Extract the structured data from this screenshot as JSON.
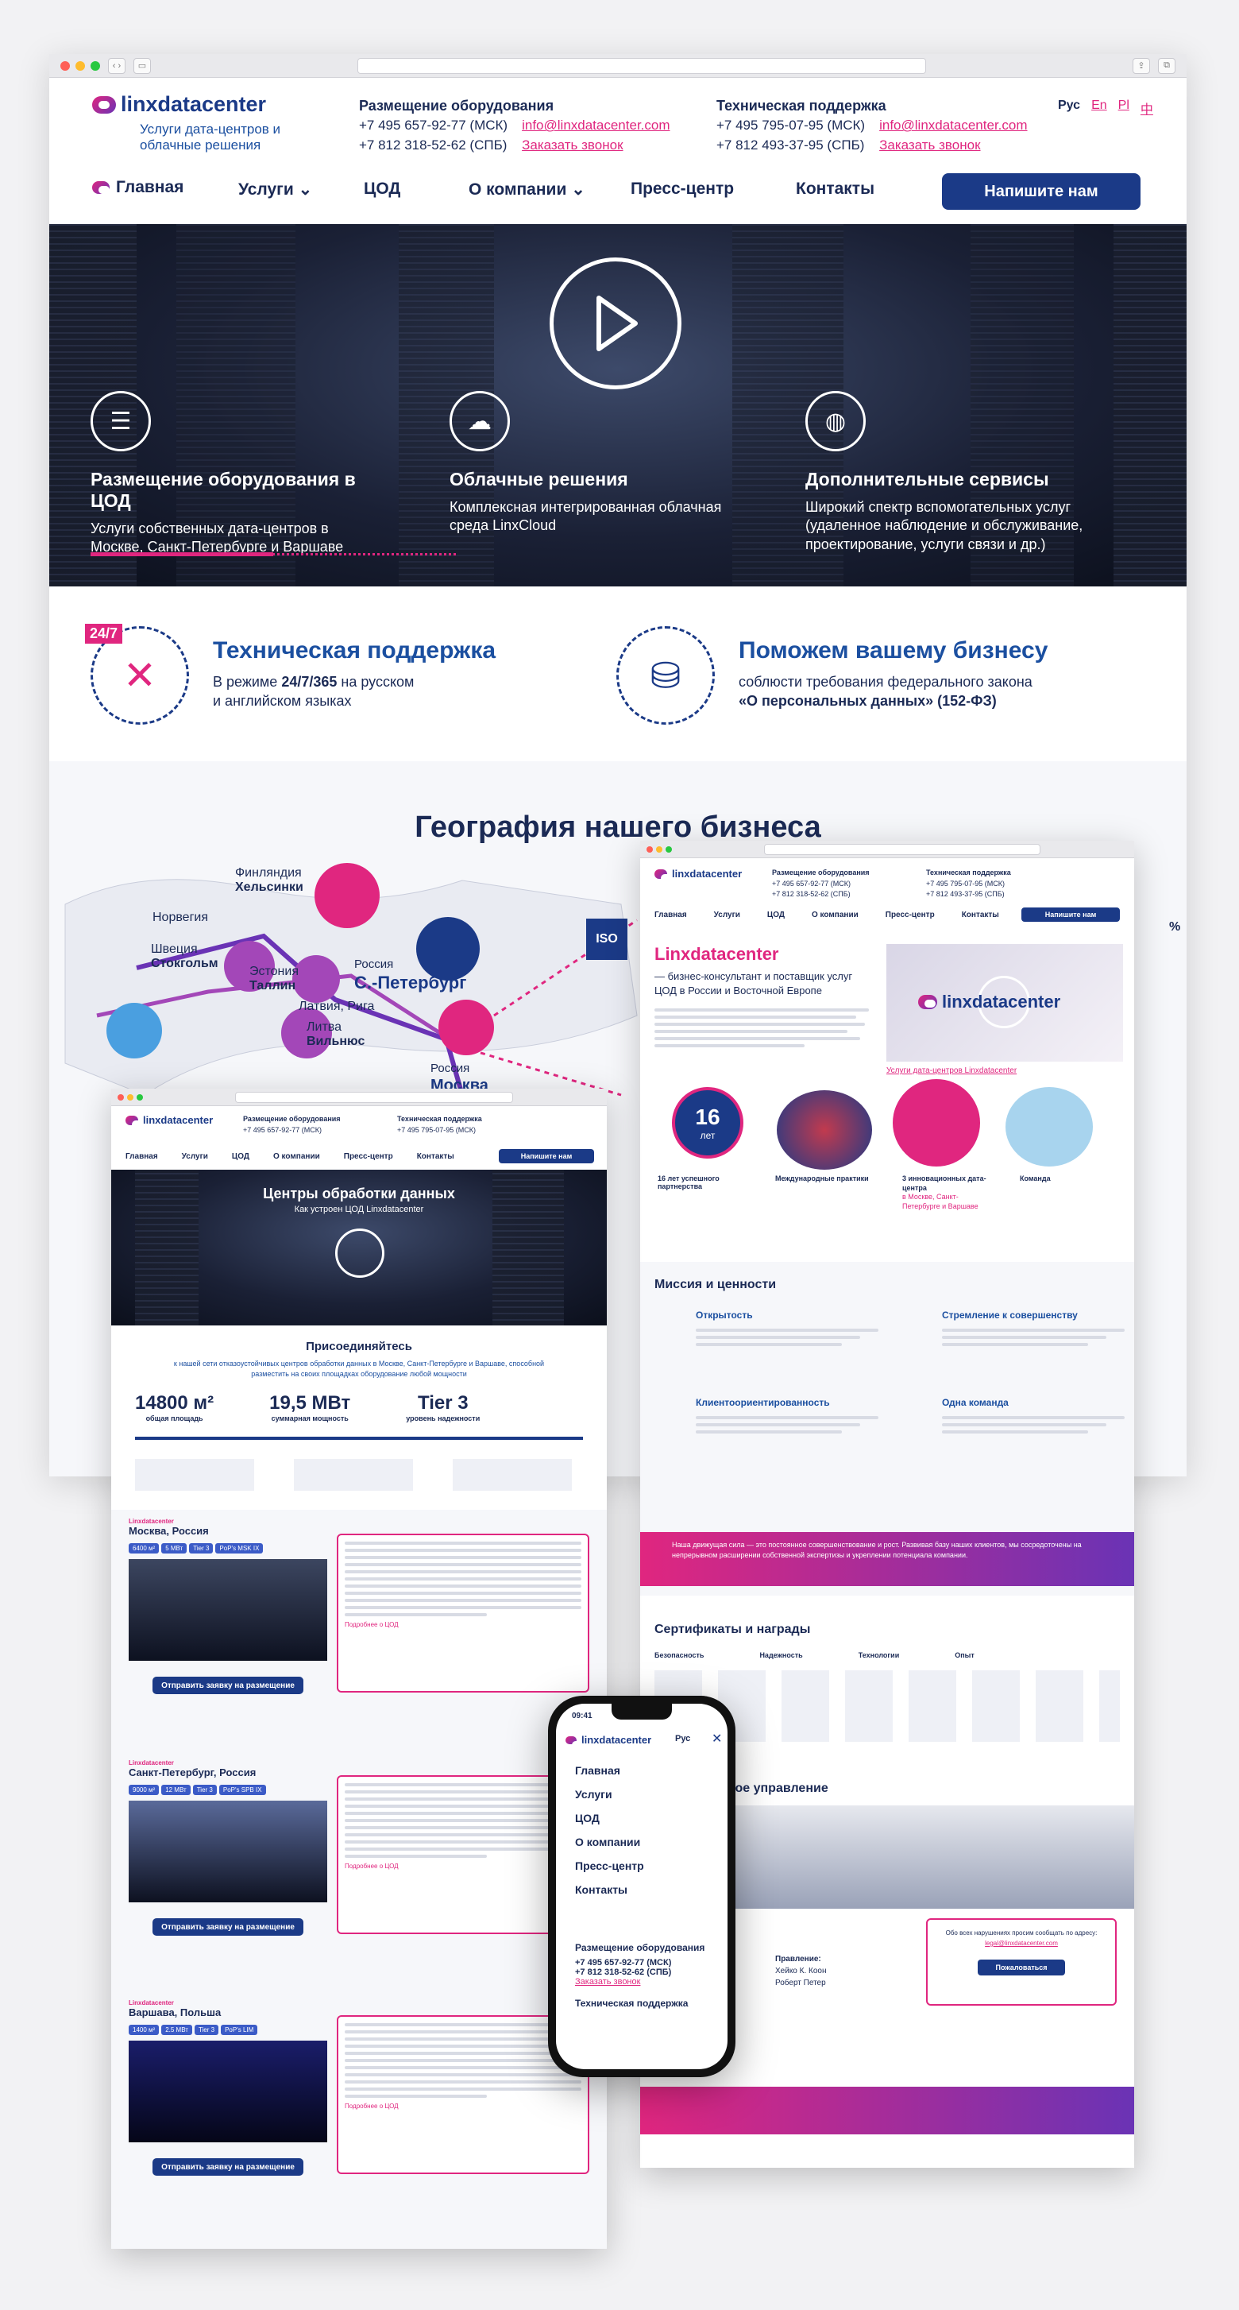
{
  "brand": {
    "name": "linxdatacenter",
    "tagline": "Услуги дата-центров и облачные решения"
  },
  "header": {
    "col1_title": "Размещение оборудования",
    "col1_phone1": "+7 495 657-92-77 (МСК)",
    "col1_phone2": "+7 812 318-52-62 (СПБ)",
    "col1_email": "info@linxdatacenter.com",
    "col1_callback": "Заказать звонок",
    "col2_title": "Техническая поддержка",
    "col2_phone1": "+7 495 795-07-95 (МСК)",
    "col2_phone2": "+7 812 493-37-95 (СПБ)",
    "col2_email": "info@linxdatacenter.com",
    "col2_callback": "Заказать звонок",
    "lang_ru": "Рус",
    "lang_en": "En",
    "lang_pl": "Pl",
    "lang_zh": "中"
  },
  "nav": {
    "home": "Главная",
    "services": "Услуги",
    "dc": "ЦОД",
    "about": "О компании",
    "press": "Пресс-центр",
    "contacts": "Контакты",
    "cta": "Напишите нам"
  },
  "hero": {
    "s1_title": "Размещение оборудования в ЦОД",
    "s1_desc": "Услуги собственных дата-центров в Москве, Санкт-Петербурге и Варшаве",
    "s2_title": "Облачные решения",
    "s2_desc": "Комплексная интегрированная облачная среда LinxCloud",
    "s3_title": "Дополнительные сервисы",
    "s3_desc": "Широкий спектр вспомогательных услуг (удаленное наблюдение и обслуживание, проектирование, услуги связи и др.)",
    "progress": 0.5
  },
  "features": {
    "f1_badge": "24/7",
    "f1_title": "Техническая поддержка",
    "f1_text_pre": "В режиме ",
    "f1_text_bold": "24/7/365",
    "f1_text_post": " на русском",
    "f1_text_line2": "и английском языках",
    "f2_title": "Поможем вашему бизнесу",
    "f2_text": "соблюсти требования федерального закона",
    "f2_text_bold": "«О персональных данных» (152-ФЗ)"
  },
  "geo": {
    "title": "География нашего бизнеса",
    "cities": [
      {
        "country": "Финляндия",
        "city": "Хельсинки"
      },
      {
        "country": "Норвегия",
        "city": ""
      },
      {
        "country": "Швеция",
        "city": "Стокгольм"
      },
      {
        "country": "Эстония",
        "city": "Таллин"
      },
      {
        "country": "Россия",
        "city": "С.-Петербург"
      },
      {
        "country": "Латвия, Рига",
        "city": ""
      },
      {
        "country": "Литва",
        "city": "Вильнюс"
      },
      {
        "country": "Россия",
        "city": "Москва"
      }
    ],
    "iso": "ISO",
    "pct": "%"
  },
  "about_window": {
    "title": "Linxdatacenter",
    "subtitle": "— бизнес-консультант и поставщик услуг ЦОД в России и Восточной Европе",
    "video_caption": "Услуги дата-центров Linxdatacenter",
    "years_num": "16",
    "years_label": "лет",
    "stat1": "16 лет успешного партнерства",
    "stat2": "Международные практики",
    "stat3": "3 инновационных дата-центра",
    "stat3_sub": "в Москве, Санкт-Петербурге и Варшаве",
    "stat4": "Команда",
    "mission_title": "Миссия и ценности",
    "v1": "Открытость",
    "v2": "Стремление к совершенству",
    "v3": "Клиентоориентированность",
    "v4": "Одна команда",
    "banner": "Наша движущая сила — это постоянное совершенствование и рост. Развивая базу наших клиентов, мы сосредоточены на непрерывном расширении собственной экспертизы и укреплении потенциала компании.",
    "certs_title": "Сертификаты и награды",
    "c1": "Безопасность",
    "c2": "Надежность",
    "c3": "Технологии",
    "c4": "Опыт",
    "mgmt_title": "вное управление",
    "mgmt_board": "Правление:",
    "mgmt_p1": "Хейко К. Коон",
    "mgmt_p2": "Роберт Петер",
    "contact_text": "Обо всех нарушениях просим сообщать по адресу:",
    "contact_email": "legal@linxdatacenter.com",
    "contact_btn": "Пожаловаться"
  },
  "dc_window": {
    "title": "Центры обработки данных",
    "subtitle": "Как устроен ЦОД Linxdatacenter",
    "join_title": "Присоединяйтесь",
    "join_text": "к нашей сети отказоустойчивых центров обработки данных в Москве, Санкт-Петербурге и Варшаве, способной разместить на своих площадках оборудование любой мощности",
    "m1_value": "14800 м²",
    "m1_label": "общая площадь",
    "m2_value": "19,5 МВт",
    "m2_label": "суммарная мощность",
    "m3_value": "Tier 3",
    "m3_label": "уровень надежности",
    "dc1": "Москва, Россия",
    "dc2": "Санкт-Петербург, Россия",
    "dc3": "Варшава, Польша",
    "dc_brand": "Linxdatacenter",
    "badges1": [
      "6400 м²",
      "5 МВт",
      "Tier 3",
      "PoP's MSK IX"
    ],
    "badges2": [
      "9000 м²",
      "12 МВт",
      "Tier 3",
      "PoP's SPB IX"
    ],
    "badges3": [
      "1400 м²",
      "2.5 МВт",
      "Tier 3",
      "PoP's LIM"
    ],
    "order_btn": "Отправить заявку на размещение",
    "more_link": "Подробнее о ЦОД"
  },
  "phone": {
    "time": "09:41",
    "lang": "Рус",
    "menu": [
      "Главная",
      "Услуги",
      "ЦОД",
      "О компании",
      "Пресс-центр",
      "Контакты"
    ],
    "sect1": "Размещение оборудования",
    "ph1": "+7 495 657-92-77 (МСК)",
    "ph2": "+7 812 318-52-62 (СПБ)",
    "callback": "Заказать звонок",
    "sect2": "Техническая поддержка"
  },
  "colors": {
    "navy": "#1b3a87",
    "pink": "#e0267f",
    "purple": "#6a33b5"
  }
}
